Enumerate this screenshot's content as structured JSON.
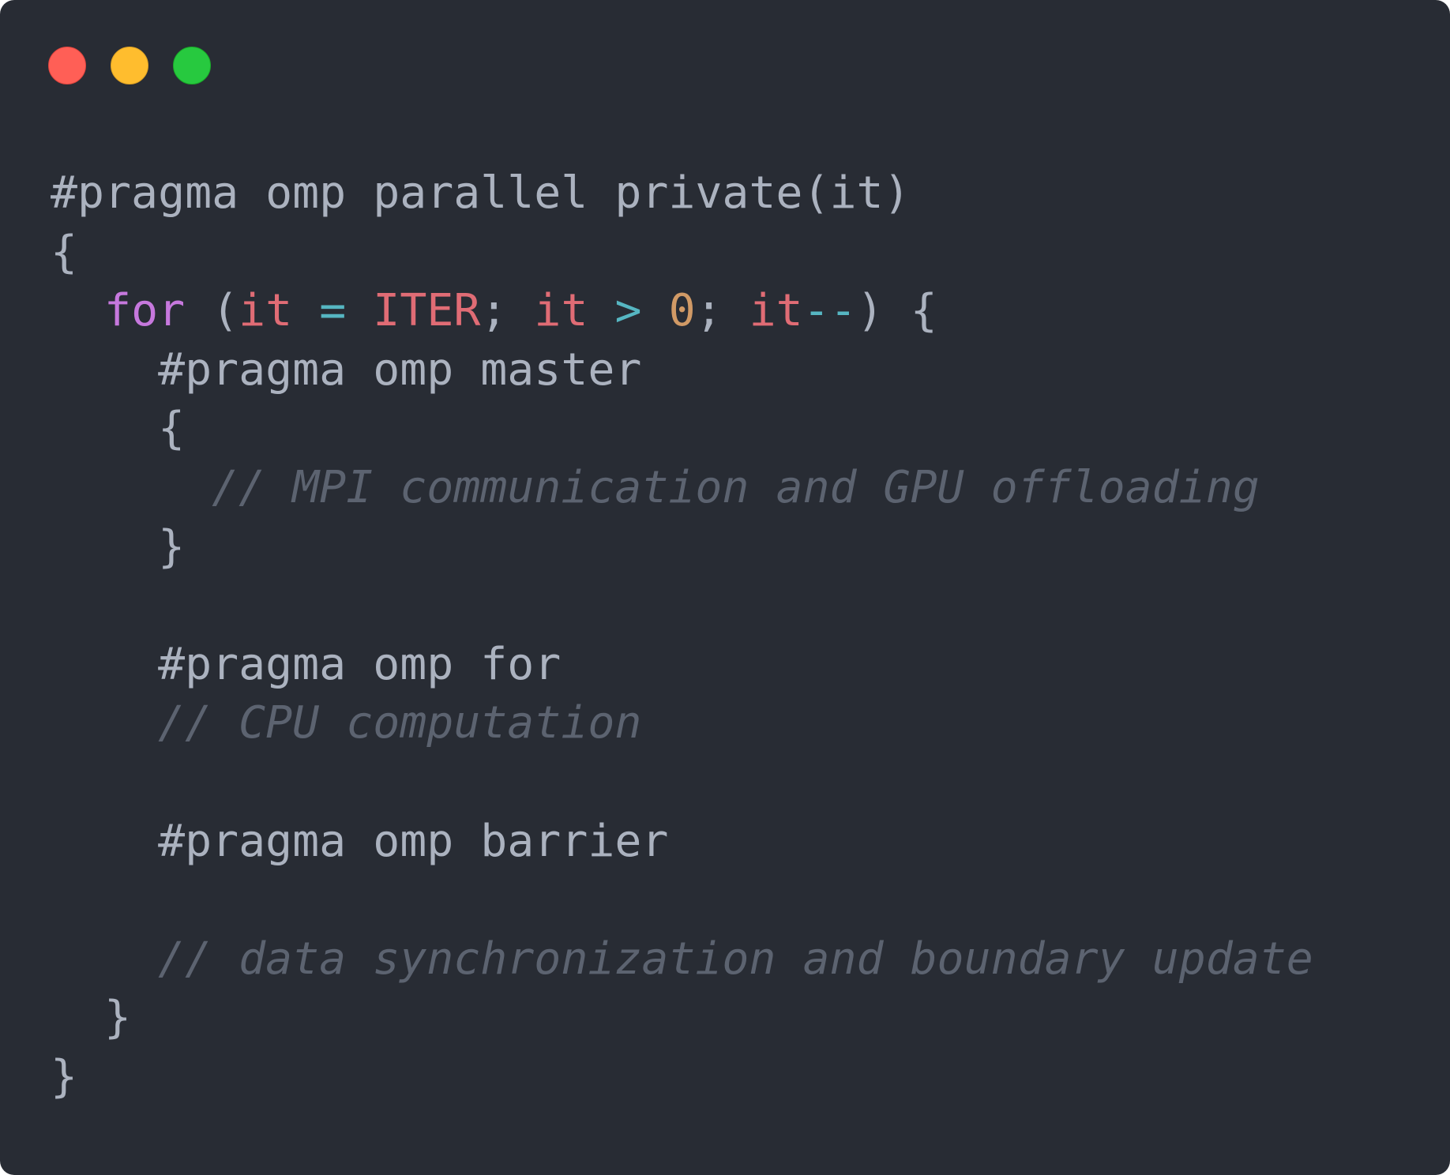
{
  "window": {
    "traffic_lights": [
      {
        "name": "close",
        "color": "#ff5f56"
      },
      {
        "name": "minimize",
        "color": "#ffbd2e"
      },
      {
        "name": "maximize",
        "color": "#27c93f"
      }
    ],
    "background": "#282c34"
  },
  "code": {
    "lines": [
      {
        "indent": "",
        "tokens": [
          {
            "t": "#pragma omp parallel private(it)",
            "k": "default"
          }
        ]
      },
      {
        "indent": "",
        "tokens": [
          {
            "t": "{",
            "k": "default"
          }
        ]
      },
      {
        "indent": "  ",
        "tokens": [
          {
            "t": "for",
            "k": "keyword"
          },
          {
            "t": " (",
            "k": "default"
          },
          {
            "t": "it",
            "k": "var"
          },
          {
            "t": " ",
            "k": "default"
          },
          {
            "t": "=",
            "k": "op"
          },
          {
            "t": " ",
            "k": "default"
          },
          {
            "t": "ITER",
            "k": "var"
          },
          {
            "t": "; ",
            "k": "default"
          },
          {
            "t": "it",
            "k": "var"
          },
          {
            "t": " ",
            "k": "default"
          },
          {
            "t": ">",
            "k": "op"
          },
          {
            "t": " ",
            "k": "default"
          },
          {
            "t": "0",
            "k": "num"
          },
          {
            "t": "; ",
            "k": "default"
          },
          {
            "t": "it",
            "k": "var"
          },
          {
            "t": "--",
            "k": "op"
          },
          {
            "t": ") {",
            "k": "default"
          }
        ]
      },
      {
        "indent": "    ",
        "tokens": [
          {
            "t": "#pragma omp master",
            "k": "default"
          }
        ]
      },
      {
        "indent": "    ",
        "tokens": [
          {
            "t": "{",
            "k": "default"
          }
        ]
      },
      {
        "indent": "      ",
        "tokens": [
          {
            "t": "// MPI communication and GPU offloading",
            "k": "comment"
          }
        ]
      },
      {
        "indent": "    ",
        "tokens": [
          {
            "t": "}",
            "k": "default"
          }
        ]
      },
      {
        "indent": "",
        "tokens": []
      },
      {
        "indent": "    ",
        "tokens": [
          {
            "t": "#pragma omp for",
            "k": "default"
          }
        ]
      },
      {
        "indent": "    ",
        "tokens": [
          {
            "t": "// CPU computation",
            "k": "comment"
          }
        ]
      },
      {
        "indent": "",
        "tokens": []
      },
      {
        "indent": "    ",
        "tokens": [
          {
            "t": "#pragma omp barrier",
            "k": "default"
          }
        ]
      },
      {
        "indent": "",
        "tokens": []
      },
      {
        "indent": "    ",
        "tokens": [
          {
            "t": "// data synchronization and boundary update",
            "k": "comment"
          }
        ]
      },
      {
        "indent": "  ",
        "tokens": [
          {
            "t": "}",
            "k": "default"
          }
        ]
      },
      {
        "indent": "",
        "tokens": [
          {
            "t": "}",
            "k": "default"
          }
        ]
      }
    ]
  }
}
